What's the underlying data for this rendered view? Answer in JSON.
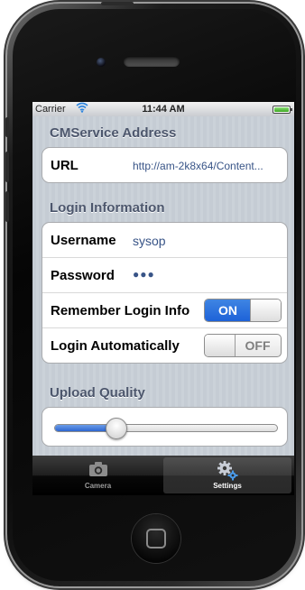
{
  "status_bar": {
    "carrier": "Carrier",
    "time": "11:44 AM",
    "battery_level": 1.0
  },
  "sections": {
    "cmservice": {
      "header": "CMService Address",
      "url_label": "URL",
      "url_value": "http://am-2k8x64/Content..."
    },
    "login": {
      "header": "Login Information",
      "username_label": "Username",
      "username_value": "sysop",
      "password_label": "Password",
      "password_value": "●●●",
      "remember_label": "Remember Login Info",
      "remember_state": "ON",
      "auto_label": "Login Automatically",
      "auto_state": "OFF"
    },
    "upload": {
      "header": "Upload Quality",
      "slider_value": 0.25
    }
  },
  "tab_bar": {
    "tabs": [
      {
        "label": "Camera",
        "icon": "camera-icon",
        "selected": false
      },
      {
        "label": "Settings",
        "icon": "gears-icon",
        "selected": true
      }
    ]
  },
  "colors": {
    "section_header": "#4c566c",
    "value_text": "#385487",
    "toggle_on": "#2f74de",
    "background_stripe": "#c5ccd4"
  }
}
